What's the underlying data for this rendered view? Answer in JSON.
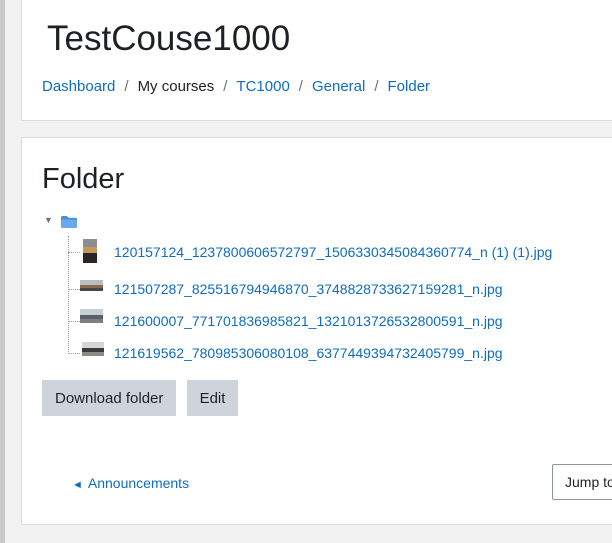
{
  "header": {
    "course_title": "TestCouse1000",
    "breadcrumb": [
      {
        "label": "Dashboard",
        "link": true
      },
      {
        "label": "My courses",
        "link": false
      },
      {
        "label": "TC1000",
        "link": true
      },
      {
        "label": "General",
        "link": true
      },
      {
        "label": "Folder",
        "link": true
      }
    ],
    "separator": "/"
  },
  "main": {
    "heading": "Folder",
    "tree": {
      "toggle_icon": "triangle-down-icon",
      "folder_icon": "folder-icon",
      "files": [
        {
          "name": "120157124_1237800606572797_1506330345084360774_n (1) (1).jpg",
          "thumb": "portrait-photo"
        },
        {
          "name": "121507287_825516794946870_3748828733627159281_n.jpg",
          "thumb": "landscape-photo"
        },
        {
          "name": "121600007_771701836985821_1321013726532800591_n.jpg",
          "thumb": "landscape-photo"
        },
        {
          "name": "121619562_780985306080108_6377449394732405799_n.jpg",
          "thumb": "landscape-photo"
        }
      ]
    },
    "buttons": {
      "download_label": "Download folder",
      "edit_label": "Edit"
    },
    "activity_nav": {
      "prev_arrow": "◄",
      "prev_label": "Announcements",
      "jump_label": "Jump to..."
    }
  },
  "colors": {
    "link": "#0f6cbf",
    "text": "#1d2125",
    "button_bg": "#ced4da",
    "folder_icon": "#4a90d9"
  }
}
